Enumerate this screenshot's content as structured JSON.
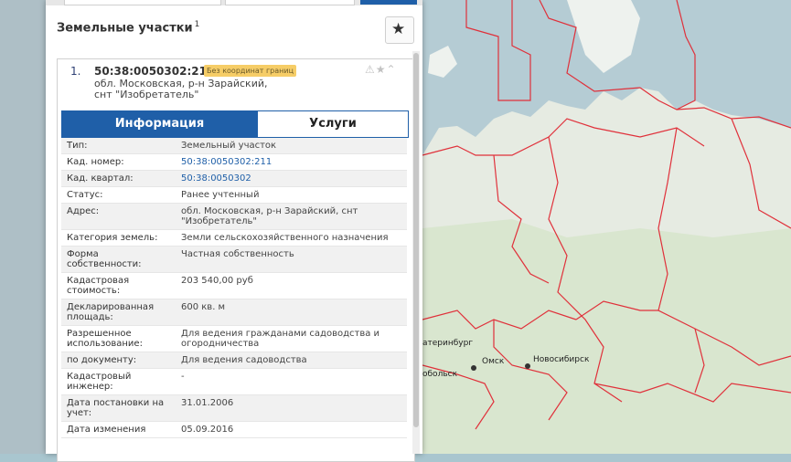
{
  "panel": {
    "title": "Земельные участки",
    "title_count": "1"
  },
  "parcel": {
    "index": "1.",
    "cad_number": "50:38:0050302:211",
    "badge": "Без координат границ",
    "address": "обл. Московская, р-н Зарайский, снт \"Изобретатель\""
  },
  "tabs": {
    "info": "Информация",
    "services": "Услуги"
  },
  "rows": [
    {
      "key": "Тип:",
      "value": "Земельный участок"
    },
    {
      "key": "Кад. номер:",
      "value": "50:38:0050302:211"
    },
    {
      "key": "Кад. квартал:",
      "value": "50:38:0050302"
    },
    {
      "key": "Статус:",
      "value": "Ранее учтенный"
    },
    {
      "key": "Адрес:",
      "value": "обл. Московская, р-н Зарайский, снт \"Изобретатель\""
    },
    {
      "key": "Категория земель:",
      "value": "Земли сельскохозяйственного назначения"
    },
    {
      "key": "Форма собственности:",
      "value": "Частная собственность"
    },
    {
      "key": "Кадастровая стоимость:",
      "value": "203 540,00 руб"
    },
    {
      "key": "Декларированная площадь:",
      "value": "600 кв. м"
    },
    {
      "key": "Разрешенное использование:",
      "value": "Для ведения гражданами садоводства и огородничества"
    },
    {
      "key": "по документу:",
      "value": "Для ведения садоводства"
    },
    {
      "key": "Кадастровый инженер:",
      "value": "-"
    },
    {
      "key": "Дата постановки на учет:",
      "value": "31.01.2006"
    },
    {
      "key": "Дата изменения",
      "value": "05.09.2016"
    }
  ],
  "map": {
    "labels": {
      "city1": "Омск",
      "city2": "Новосибирск",
      "city3": "атеринбург",
      "city4": "обольск"
    }
  },
  "icons": {
    "star": "star-icon",
    "card_actions": [
      "warning-icon",
      "star-icon",
      "collapse-icon"
    ]
  }
}
